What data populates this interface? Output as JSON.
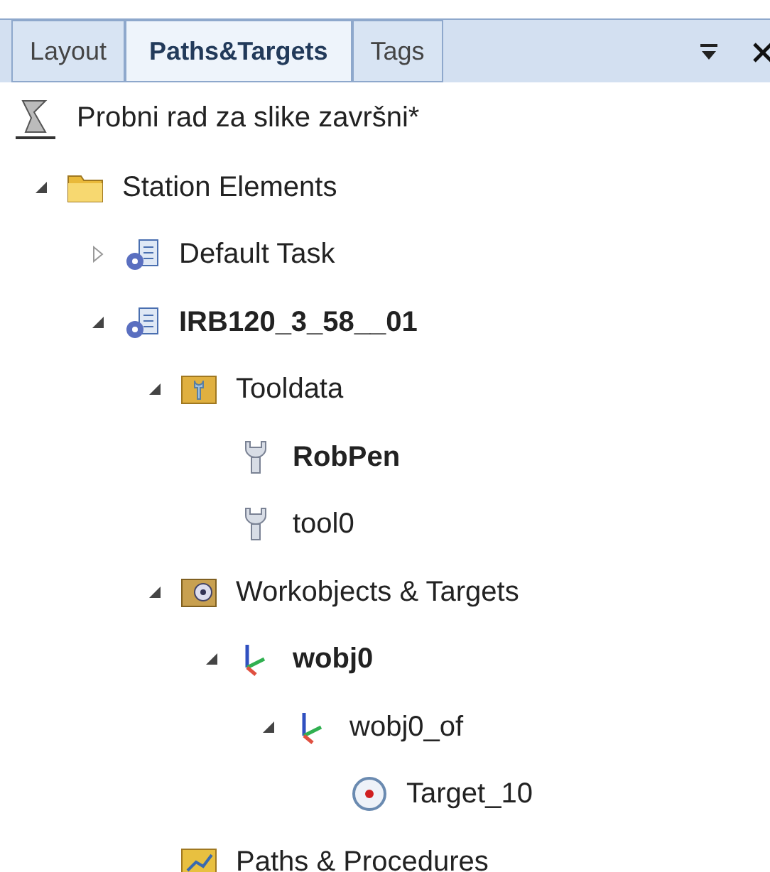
{
  "tabs": [
    {
      "label": "Layout",
      "selected": false
    },
    {
      "label": "Paths&Targets",
      "selected": true
    },
    {
      "label": "Tags",
      "selected": false
    }
  ],
  "station": {
    "label": "Probni rad za slike završni*"
  },
  "tree": [
    {
      "label": "Station Elements",
      "kind": "folder",
      "bold": false,
      "expanded": true,
      "children": [
        {
          "label": "Default Task",
          "kind": "task",
          "bold": false,
          "expanded": false
        },
        {
          "label": "IRB120_3_58__01",
          "kind": "task",
          "bold": true,
          "expanded": true,
          "children": [
            {
              "label": "Tooldata",
              "kind": "tooldata",
              "bold": false,
              "expanded": true,
              "children": [
                {
                  "label": "RobPen",
                  "kind": "tool",
                  "bold": true
                },
                {
                  "label": "tool0",
                  "kind": "tool",
                  "bold": false
                }
              ]
            },
            {
              "label": "Workobjects & Targets",
              "kind": "workobjects",
              "bold": false,
              "expanded": true,
              "children": [
                {
                  "label": "wobj0",
                  "kind": "frame",
                  "bold": true,
                  "expanded": true,
                  "children": [
                    {
                      "label": "wobj0_of",
                      "kind": "frame",
                      "bold": false,
                      "expanded": true,
                      "children": [
                        {
                          "label": "Target_10",
                          "kind": "target",
                          "bold": false
                        }
                      ]
                    }
                  ]
                }
              ]
            },
            {
              "label": "Paths & Procedures",
              "kind": "paths",
              "bold": false
            }
          ]
        }
      ]
    }
  ]
}
